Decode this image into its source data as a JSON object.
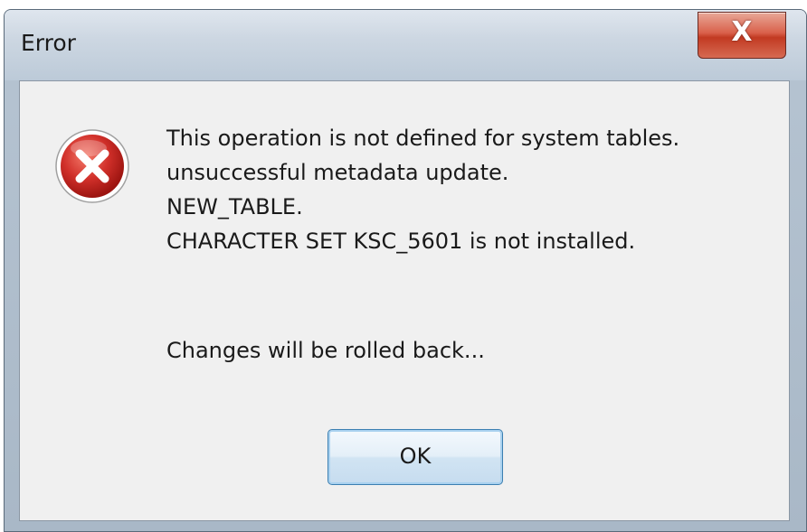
{
  "window": {
    "title": "Error",
    "close_glyph": "X"
  },
  "message": {
    "lines": [
      "This operation is not defined for system tables.",
      "unsuccessful metadata update.",
      "NEW_TABLE.",
      "CHARACTER SET KSC_5601 is not installed."
    ],
    "rollback": "Changes will be rolled back..."
  },
  "buttons": {
    "ok_label": "OK"
  },
  "icons": {
    "error": "error-x-circle-icon",
    "close": "close-icon"
  },
  "colors": {
    "error_red": "#c8281e",
    "close_button": "#c94a34",
    "ok_border": "#3c7fb1",
    "client_background": "#f0f0f0"
  }
}
